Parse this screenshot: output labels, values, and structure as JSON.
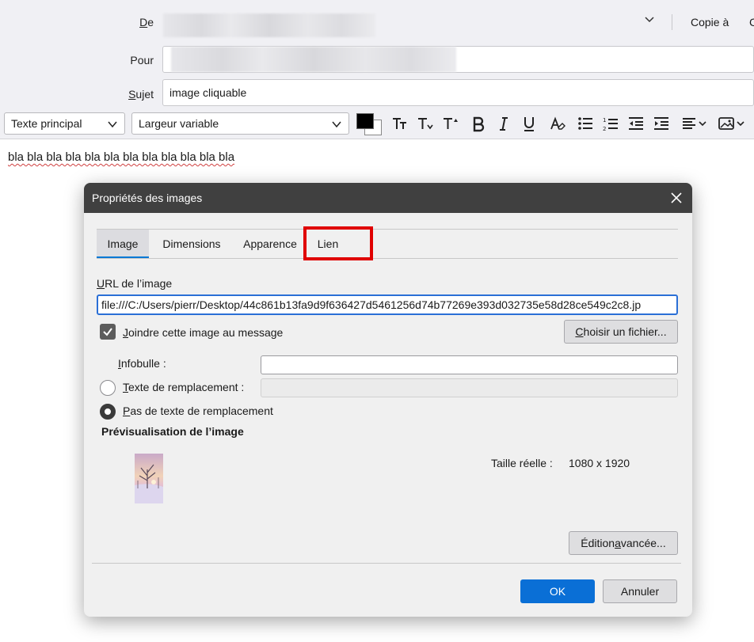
{
  "compose": {
    "from_label": "De",
    "to_label": "Pour",
    "subject_label": "Sujet",
    "subject_value": "image cliquable",
    "cc_label": "Copie à",
    "cc_overflow": "C"
  },
  "toolbar": {
    "paragraph_format": "Texte principal",
    "font": "Largeur variable",
    "text_color": "#000000",
    "background_color": "#ffffff",
    "icons": [
      "font-smaller-icon",
      "font-larger-icon",
      "superscript-size-icon",
      "bold-icon",
      "italic-icon",
      "underline-icon",
      "clear-formatting-icon",
      "bulleted-list-icon",
      "numbered-list-icon",
      "outdent-icon",
      "indent-icon",
      "align-menu-icon",
      "insert-image-menu-icon"
    ]
  },
  "body": {
    "text": "bla bla bla bla bla bla bla bla bla bla bla bla"
  },
  "dialog": {
    "title": "Propriétés des images",
    "tabs": [
      {
        "label": "Image",
        "active": true
      },
      {
        "label": "Dimensions",
        "active": false
      },
      {
        "label": "Apparence",
        "active": false
      },
      {
        "label": "Lien",
        "active": false,
        "highlighted": true
      }
    ],
    "url_label": "URL de l’image",
    "url_value": "file:///C:/Users/pierr/Desktop/44c861b13fa9d9f636427d5461256d74b77269e393d032735e58d28ce549c2c8.jp",
    "attach_checkbox": {
      "label": "Joindre cette image au message",
      "checked": true
    },
    "choose_file_button": "Choisir un fichier...",
    "tooltip_label": "Infobulle :",
    "tooltip_value": "",
    "alt_text_radio": {
      "label": "Texte de remplacement :",
      "checked": false
    },
    "alt_text_value": "",
    "no_alt_radio": {
      "label": "Pas de texte de remplacement",
      "checked": true
    },
    "preview_title": "Prévisualisation de l’image",
    "actual_size_label": "Taille réelle :",
    "actual_size_value": "1080  x 1920",
    "advanced_edit_button": "Édition avancée...",
    "ok_button": "OK",
    "cancel_button": "Annuler"
  },
  "colors": {
    "accent": "#0a6fd6",
    "highlight": "#e00000",
    "titlebar": "#404040"
  }
}
